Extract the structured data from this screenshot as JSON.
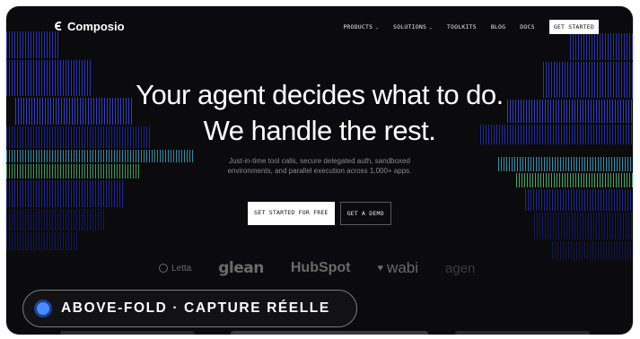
{
  "nav": {
    "brand": "Composio",
    "items": [
      {
        "label": "PRODUCTS",
        "has_dropdown": true
      },
      {
        "label": "SOLUTIONS",
        "has_dropdown": true
      },
      {
        "label": "TOOLKITS",
        "has_dropdown": false
      },
      {
        "label": "BLOG",
        "has_dropdown": false
      },
      {
        "label": "DOCS",
        "has_dropdown": false
      }
    ],
    "cta": "GET STARTED"
  },
  "hero": {
    "title_line1": "Your agent decides what to do.",
    "title_line2": "We handle the rest.",
    "subtitle_line1": "Just-in-time tool calls, secure delegated auth, sandboxed",
    "subtitle_line2": "environments, and parallel execution across 1,000+ apps.",
    "primary_cta": "GET STARTED FOR FREE",
    "secondary_cta": "GET A DEMO"
  },
  "logos": [
    "Letta",
    "glean",
    "HubSpot",
    "wabi",
    "agen"
  ],
  "caption": "ABOVE-FOLD · CAPTURE RÉELLE",
  "colors": {
    "background": "#0b0b0d",
    "accent_blue": "#4a8cff",
    "streak_blue": "#2a3bd8",
    "streak_cyan": "#25a7c9",
    "streak_green": "#4fc77a"
  },
  "icons": {
    "logo": "composio-logo-icon",
    "dropdown": "chevron-down-icon",
    "badge": "record-dot-icon"
  }
}
